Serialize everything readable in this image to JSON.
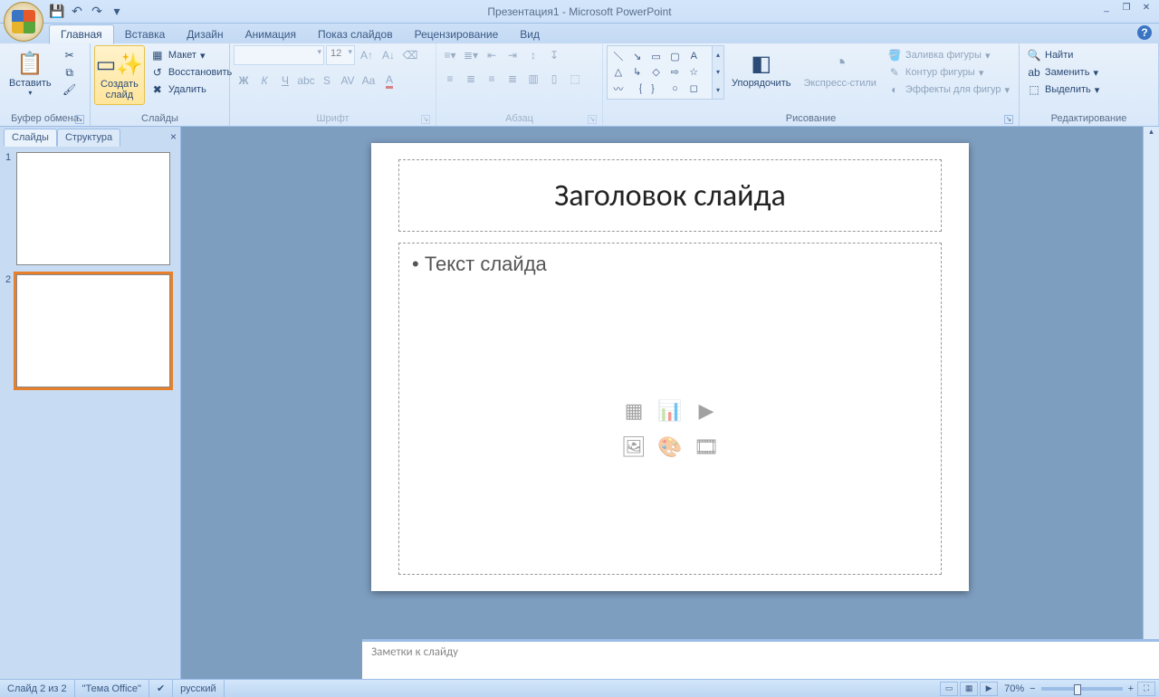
{
  "title": "Презентация1 - Microsoft PowerPoint",
  "qat": {
    "save": "💾",
    "undo": "↶",
    "redo": "↷",
    "more": "▾"
  },
  "tabs": [
    "Главная",
    "Вставка",
    "Дизайн",
    "Анимация",
    "Показ слайдов",
    "Рецензирование",
    "Вид"
  ],
  "ribbon": {
    "clipboard": {
      "paste": "Вставить",
      "label": "Буфер обмена"
    },
    "slides": {
      "new": "Создать\nслайд",
      "layout": "Макет",
      "reset": "Восстановить",
      "delete": "Удалить",
      "label": "Слайды"
    },
    "font": {
      "size": "12",
      "label": "Шрифт"
    },
    "paragraph": {
      "label": "Абзац"
    },
    "drawing": {
      "arrange": "Упорядочить",
      "quickstyles": "Экспресс-стили",
      "fill": "Заливка фигуры",
      "outline": "Контур фигуры",
      "effects": "Эффекты для фигур",
      "label": "Рисование"
    },
    "editing": {
      "find": "Найти",
      "replace": "Заменить",
      "select": "Выделить",
      "label": "Редактирование"
    }
  },
  "pane": {
    "tab1": "Слайды",
    "tab2": "Структура",
    "slides": [
      "1",
      "2"
    ]
  },
  "slide": {
    "title_placeholder": "Заголовок слайда",
    "body_placeholder": "Текст слайда"
  },
  "notes": "Заметки к слайду",
  "status": {
    "slide_info": "Слайд 2 из 2",
    "theme": "\"Тема Office\"",
    "lang": "русский",
    "zoom": "70%"
  }
}
